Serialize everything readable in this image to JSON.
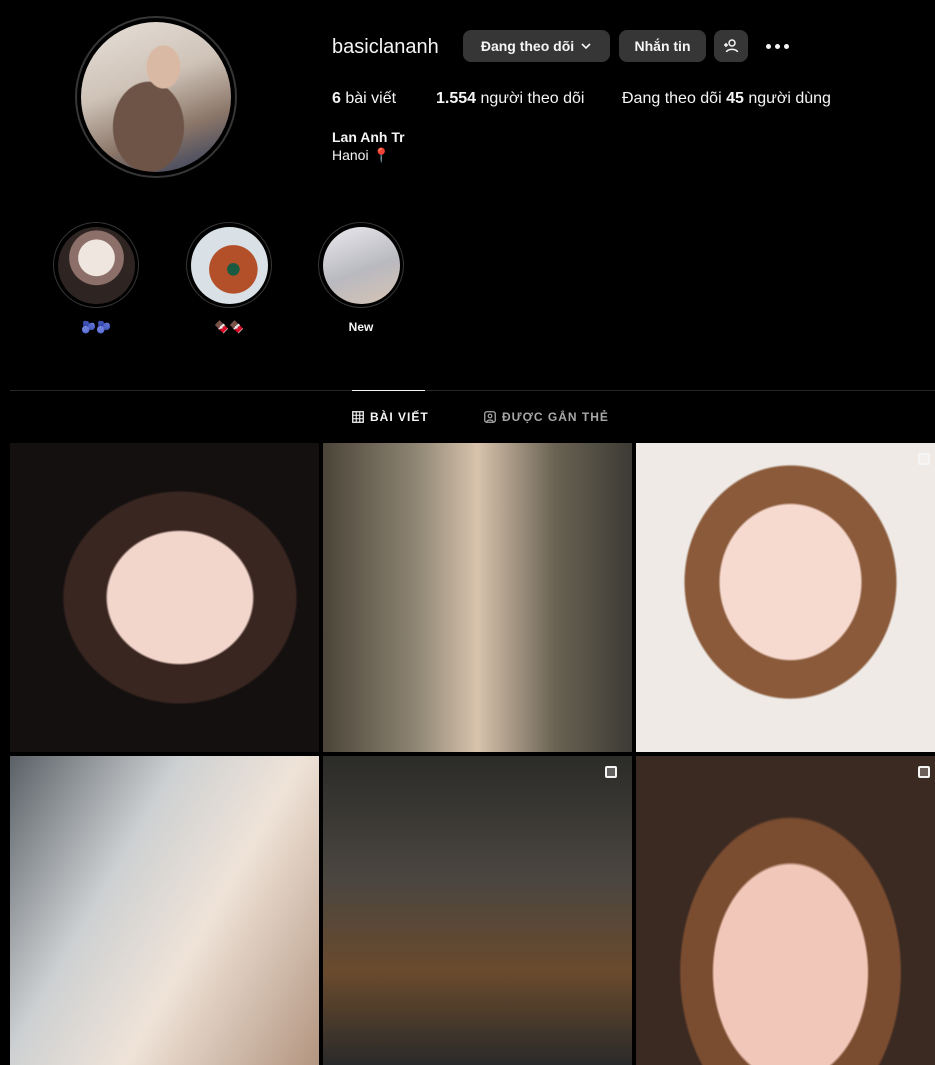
{
  "profile": {
    "username": "basiclananh",
    "follow_button": "Đang theo dõi",
    "message_button": "Nhắn tin",
    "posts_count": "6",
    "posts_label": "bài viết",
    "followers_count": "1.554",
    "followers_label": "người theo dõi",
    "following_prefix": "Đang theo dõi",
    "following_count": "45",
    "following_suffix": "người dùng",
    "full_name": "Lan Anh Tr",
    "bio": "Hanoi 📍"
  },
  "highlights": [
    {
      "label": "🫐🫐"
    },
    {
      "label": "🍫🍫"
    },
    {
      "label": "New"
    }
  ],
  "tabs": {
    "posts": "BÀI VIẾT",
    "tagged": "ĐƯỢC GẮN THẺ"
  },
  "icons": {
    "follow_chevron": "chevron-down-icon",
    "add_user": "add-user-icon",
    "more": "more-icon",
    "grid": "grid-icon",
    "tagged": "tagged-icon",
    "multi": "carousel-icon"
  },
  "colors": {
    "background": "#000000",
    "button": "#363636",
    "text": "#f5f5f5",
    "muted": "#a8a8a8"
  }
}
